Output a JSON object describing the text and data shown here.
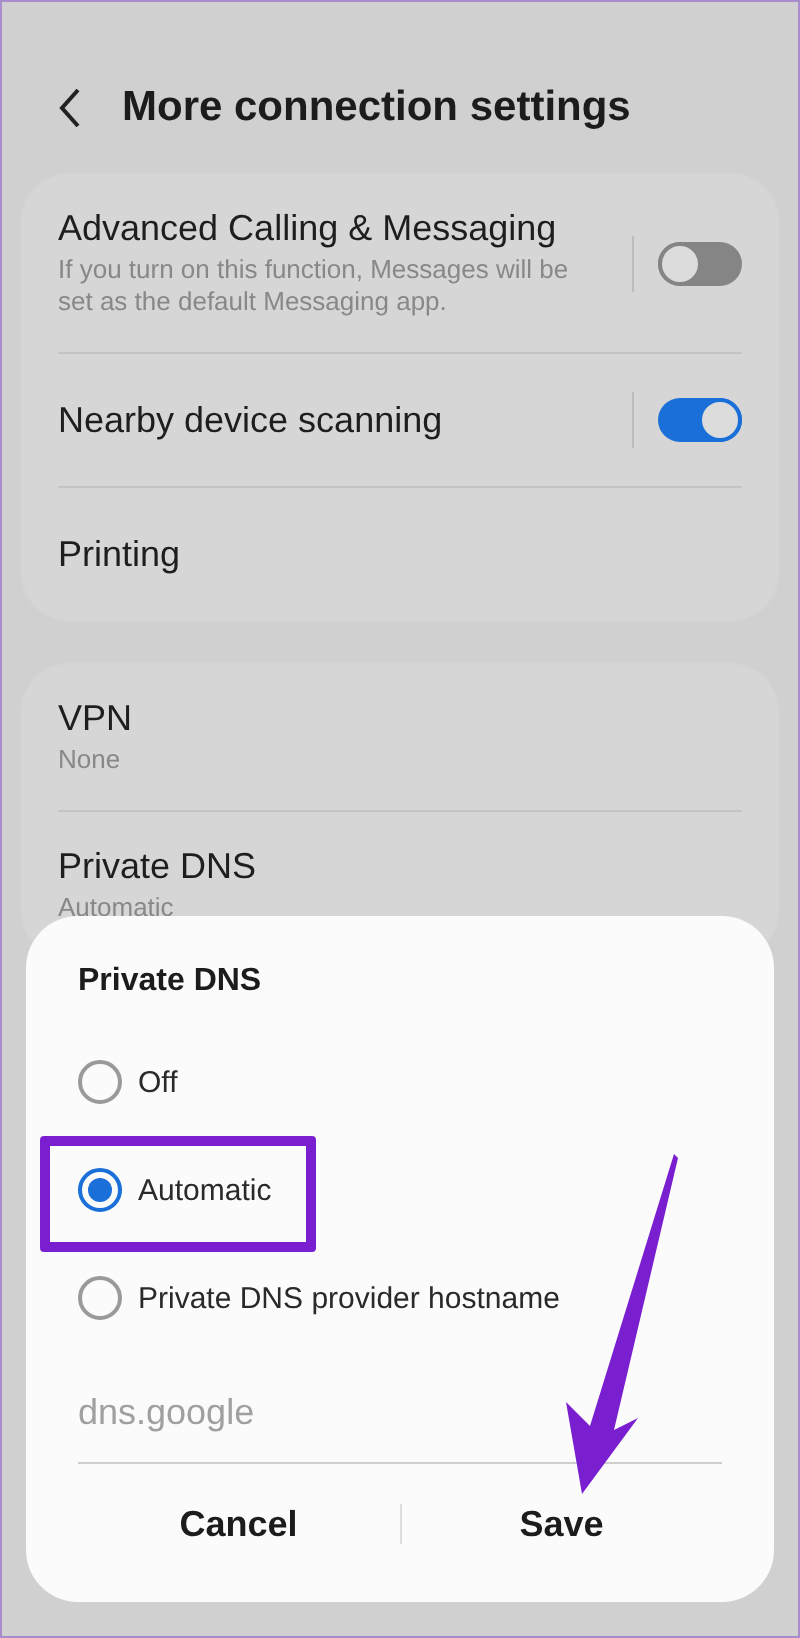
{
  "header": {
    "title": "More connection settings"
  },
  "groups": [
    {
      "items": [
        {
          "kind": "toggle",
          "title": "Advanced Calling & Messaging",
          "subtitle": "If you turn on this function, Messages will be set as the default Messaging app.",
          "on": false
        },
        {
          "kind": "toggle",
          "title": "Nearby device scanning",
          "on": true
        },
        {
          "kind": "plain",
          "title": "Printing"
        }
      ]
    },
    {
      "items": [
        {
          "kind": "plain",
          "title": "VPN",
          "subtitle": "None"
        },
        {
          "kind": "plain",
          "title": "Private DNS",
          "subtitle": "Automatic"
        }
      ]
    }
  ],
  "dialog": {
    "title": "Private DNS",
    "options": [
      {
        "label": "Off",
        "selected": false
      },
      {
        "label": "Automatic",
        "selected": true,
        "highlighted": true
      },
      {
        "label": "Private DNS provider hostname",
        "selected": false
      }
    ],
    "hostname": {
      "value": "dns.google",
      "disabled": true
    },
    "buttons": [
      "Cancel",
      "Save"
    ]
  }
}
